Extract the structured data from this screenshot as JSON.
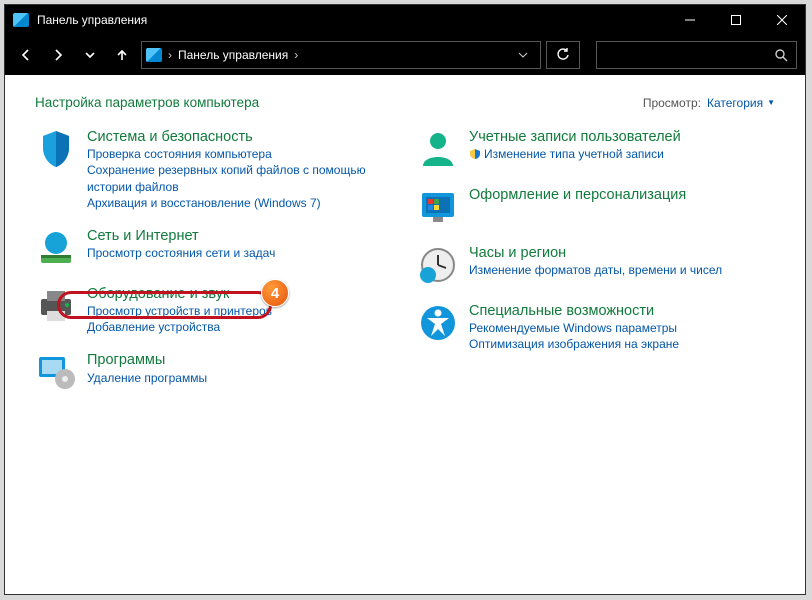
{
  "window": {
    "title": "Панель управления"
  },
  "breadcrumb": {
    "root": "Панель управления"
  },
  "header": {
    "title": "Настройка параметров компьютера",
    "view_label": "Просмотр:",
    "view_value": "Категория"
  },
  "left": {
    "system": {
      "title": "Система и безопасность",
      "l1": "Проверка состояния компьютера",
      "l2": "Сохранение резервных копий файлов с помощью истории файлов",
      "l3": "Архивация и восстановление (Windows 7)"
    },
    "network": {
      "title": "Сеть и Интернет",
      "l1": "Просмотр состояния сети и задач"
    },
    "hardware": {
      "title": "Оборудование и звук",
      "l1": "Просмотр устройств и принтеров",
      "l2": "Добавление устройства"
    },
    "programs": {
      "title": "Программы",
      "l1": "Удаление программы"
    }
  },
  "right": {
    "users": {
      "title": "Учетные записи пользователей",
      "l1": "Изменение типа учетной записи"
    },
    "personalize": {
      "title": "Оформление и персонализация"
    },
    "clock": {
      "title": "Часы и регион",
      "l1": "Изменение форматов даты, времени и чисел"
    },
    "access": {
      "title": "Специальные возможности",
      "l1": "Рекомендуемые Windows параметры",
      "l2": "Оптимизация изображения на экране"
    }
  },
  "annotation": {
    "badge": "4"
  }
}
